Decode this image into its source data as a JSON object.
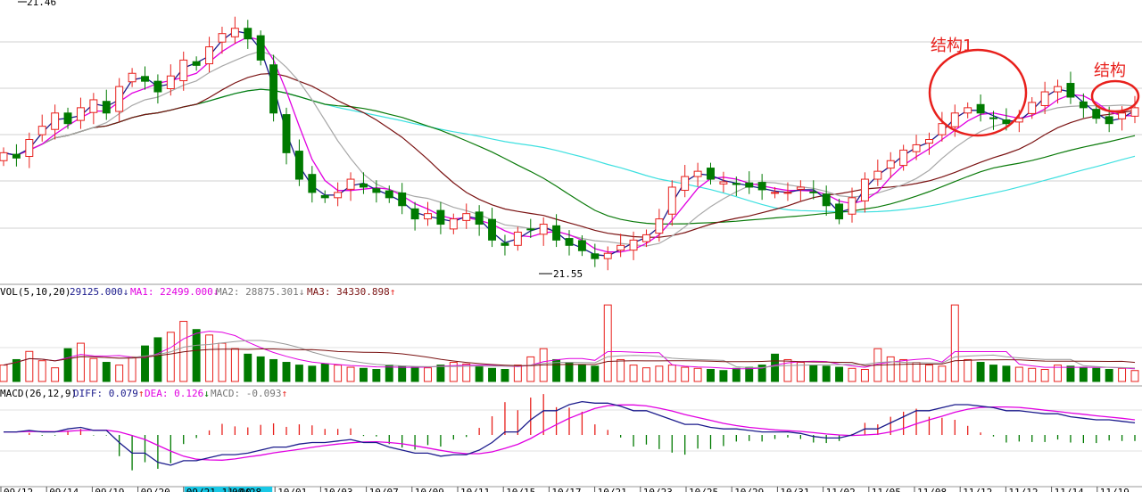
{
  "chart_data": {
    "type": "candlestick",
    "price_panel": {
      "max_price_label": "21.46",
      "min_price_label": "21.55",
      "annotations": [
        "结构1",
        "结构"
      ],
      "colors": {
        "up": "#e8201c",
        "down": "#007a00",
        "ma5": "#1b1b8c",
        "ma10": "#e100e1",
        "ma20": "#a8a8a8",
        "ma60": "#7a1212",
        "ma120": "#0a7a0a",
        "ma250": "#3ee0e0"
      }
    },
    "volume_panel": {
      "header": "VOL(5,10,20)",
      "value": "29125.000",
      "value_arrow": "↓",
      "ma1": "MA1: 22499.000",
      "ma1_arrow": "↓",
      "ma2": "MA2: 28875.301",
      "ma2_arrow": "↓",
      "ma3": "MA3: 34330.898",
      "ma3_arrow": "↑"
    },
    "macd_panel": {
      "header": "MACD(26,12,9)",
      "diff": "DIFF: 0.079",
      "diff_arrow": "↑",
      "dea": "DEA: 0.126",
      "dea_arrow": "↓",
      "macd": "MACD: -0.093",
      "macd_arrow": "↑"
    },
    "x_axis": {
      "date_labels": [
        "09/12",
        "09/14",
        "09/19",
        "09/20",
        "09/21 11:00",
        "09/28",
        "10/01",
        "10/03",
        "10/07",
        "10/09",
        "10/11",
        "10/15",
        "10/17",
        "10/21",
        "10/23",
        "10/25",
        "10/29",
        "10/31",
        "11/02",
        "11/05",
        "11/08",
        "11/12",
        "11/12",
        "11/14",
        "11/19"
      ],
      "highlighted": "09/21 11:00"
    },
    "series_close": [
      21.95,
      21.93,
      22.0,
      22.05,
      22.1,
      22.06,
      22.12,
      22.15,
      22.1,
      22.2,
      22.25,
      22.22,
      22.18,
      22.24,
      22.3,
      22.28,
      22.35,
      22.4,
      22.42,
      22.38,
      22.3,
      22.1,
      21.95,
      21.85,
      21.8,
      21.78,
      21.8,
      21.85,
      21.82,
      21.8,
      21.78,
      21.75,
      21.7,
      21.72,
      21.68,
      21.7,
      21.72,
      21.68,
      21.62,
      21.6,
      21.65,
      21.66,
      21.68,
      21.62,
      21.6,
      21.58,
      21.55,
      21.57,
      21.6,
      21.62,
      21.64,
      21.7,
      21.82,
      21.86,
      21.88,
      21.85,
      21.84,
      21.83,
      21.82,
      21.81,
      21.8,
      21.8,
      21.82,
      21.8,
      21.75,
      21.7,
      21.78,
      21.85,
      21.88,
      21.92,
      21.96,
      21.98,
      22.0,
      22.06,
      22.1,
      22.12,
      22.1,
      22.08,
      22.06,
      22.08,
      22.14,
      22.18,
      22.2,
      22.16,
      22.12,
      22.08,
      22.06,
      22.1,
      22.12
    ],
    "series_volume": [
      30,
      40,
      55,
      38,
      25,
      60,
      70,
      42,
      35,
      30,
      45,
      65,
      80,
      90,
      110,
      95,
      85,
      70,
      60,
      50,
      45,
      40,
      35,
      30,
      28,
      32,
      30,
      26,
      24,
      22,
      30,
      28,
      26,
      25,
      30,
      35,
      32,
      28,
      24,
      22,
      30,
      45,
      60,
      40,
      35,
      30,
      28,
      140,
      40,
      30,
      25,
      28,
      30,
      26,
      24,
      22,
      20,
      24,
      26,
      30,
      50,
      40,
      35,
      30,
      28,
      26,
      24,
      22,
      60,
      45,
      40,
      35,
      30,
      28,
      140,
      40,
      35,
      30,
      28,
      26,
      24,
      22,
      30,
      28,
      26,
      24,
      22,
      24,
      20
    ],
    "series_macd_diff": [
      0.02,
      0.03,
      0.02,
      0.04,
      0.05,
      0.03,
      -0.05,
      -0.12,
      -0.18,
      -0.2,
      -0.17,
      -0.15,
      -0.13,
      -0.12,
      -0.1,
      -0.08,
      -0.06,
      -0.05,
      -0.04,
      -0.03,
      -0.05,
      -0.08,
      -0.1,
      -0.12,
      -0.14,
      -0.13,
      -0.1,
      -0.05,
      0.02,
      0.1,
      0.16,
      0.2,
      0.22,
      0.21,
      0.19,
      0.16,
      0.13,
      0.1,
      0.07,
      0.05,
      0.04,
      0.03,
      0.02,
      0.02,
      0.01,
      -0.01,
      -0.02,
      0.0,
      0.04,
      0.08,
      0.12,
      0.16,
      0.18,
      0.2,
      0.19,
      0.18,
      0.16,
      0.15,
      0.14,
      0.12,
      0.11,
      0.1,
      0.09,
      0.08
    ]
  }
}
